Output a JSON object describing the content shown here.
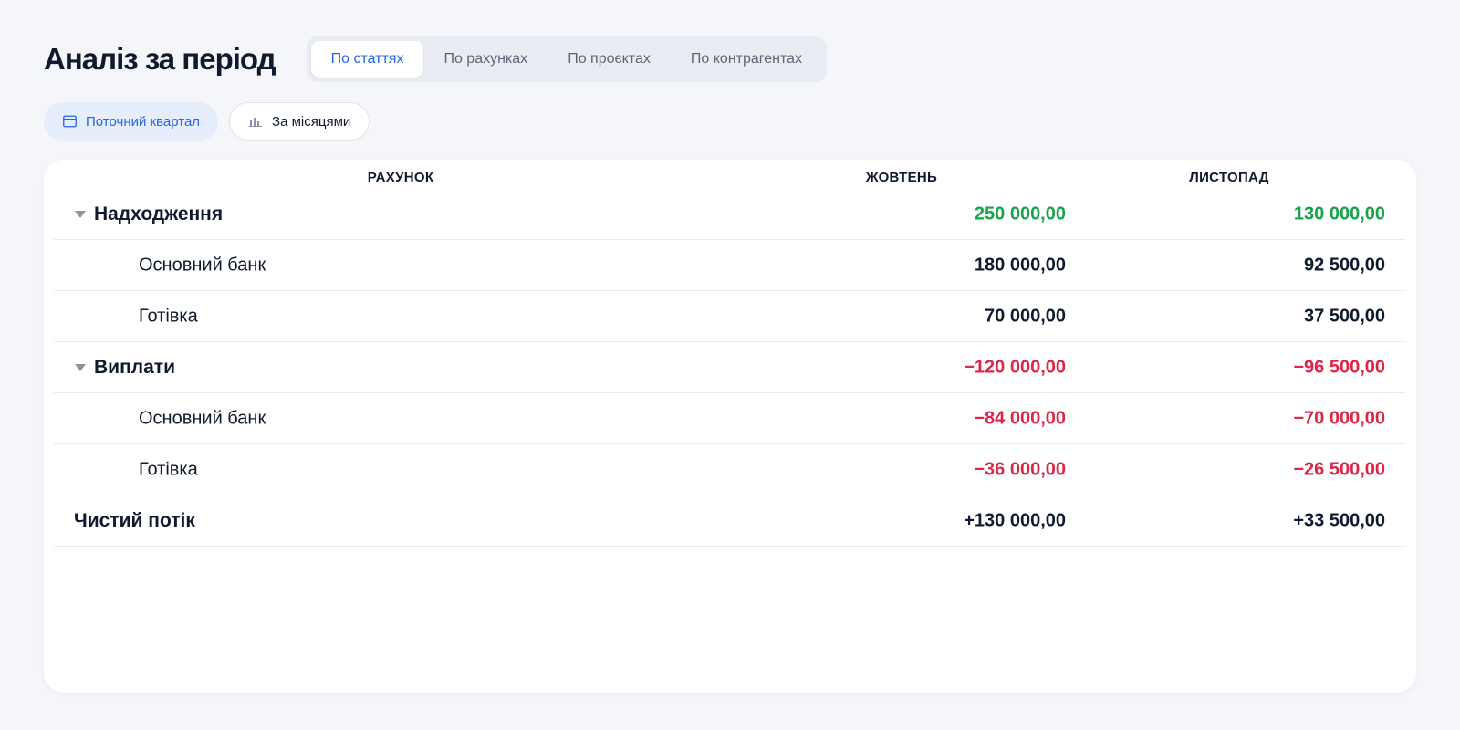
{
  "header": {
    "title": "Аналіз за період",
    "tabs": [
      {
        "label": "По статтях",
        "active": true
      },
      {
        "label": "По рахунках",
        "active": false
      },
      {
        "label": "По проєктах",
        "active": false
      },
      {
        "label": "По контрагентах",
        "active": false
      }
    ]
  },
  "filters": {
    "period": {
      "label": "Поточний квартал",
      "icon": "calendar-icon"
    },
    "grouping": {
      "label": "За місяцями",
      "icon": "bar-chart-icon"
    }
  },
  "table": {
    "columns": [
      "РАХУНОК",
      "ЖОВТЕНЬ",
      "ЛИСТОПАД"
    ],
    "rows": [
      {
        "type": "group",
        "label": "Надходження",
        "oct": "250 000,00",
        "nov": "130 000,00",
        "tone": "positive"
      },
      {
        "type": "child",
        "label": "Основний банк",
        "oct": "180 000,00",
        "nov": "92 500,00",
        "tone": "neutral"
      },
      {
        "type": "child",
        "label": "Готівка",
        "oct": "70 000,00",
        "nov": "37 500,00",
        "tone": "neutral"
      },
      {
        "type": "group",
        "label": "Виплати",
        "oct": "−120 000,00",
        "nov": "−96 500,00",
        "tone": "negative"
      },
      {
        "type": "child",
        "label": "Основний банк",
        "oct": "−84 000,00",
        "nov": "−70 000,00",
        "tone": "negative"
      },
      {
        "type": "child",
        "label": "Готівка",
        "oct": "−36 000,00",
        "nov": "−26 500,00",
        "tone": "negative"
      },
      {
        "type": "total",
        "label": "Чистий потік",
        "oct": "+130 000,00",
        "nov": "+33 500,00",
        "tone": "neutral"
      }
    ]
  },
  "colors": {
    "accent": "#2563eb",
    "positive": "#16a34a",
    "negative": "#dc2547",
    "text": "#0f1a2e"
  }
}
